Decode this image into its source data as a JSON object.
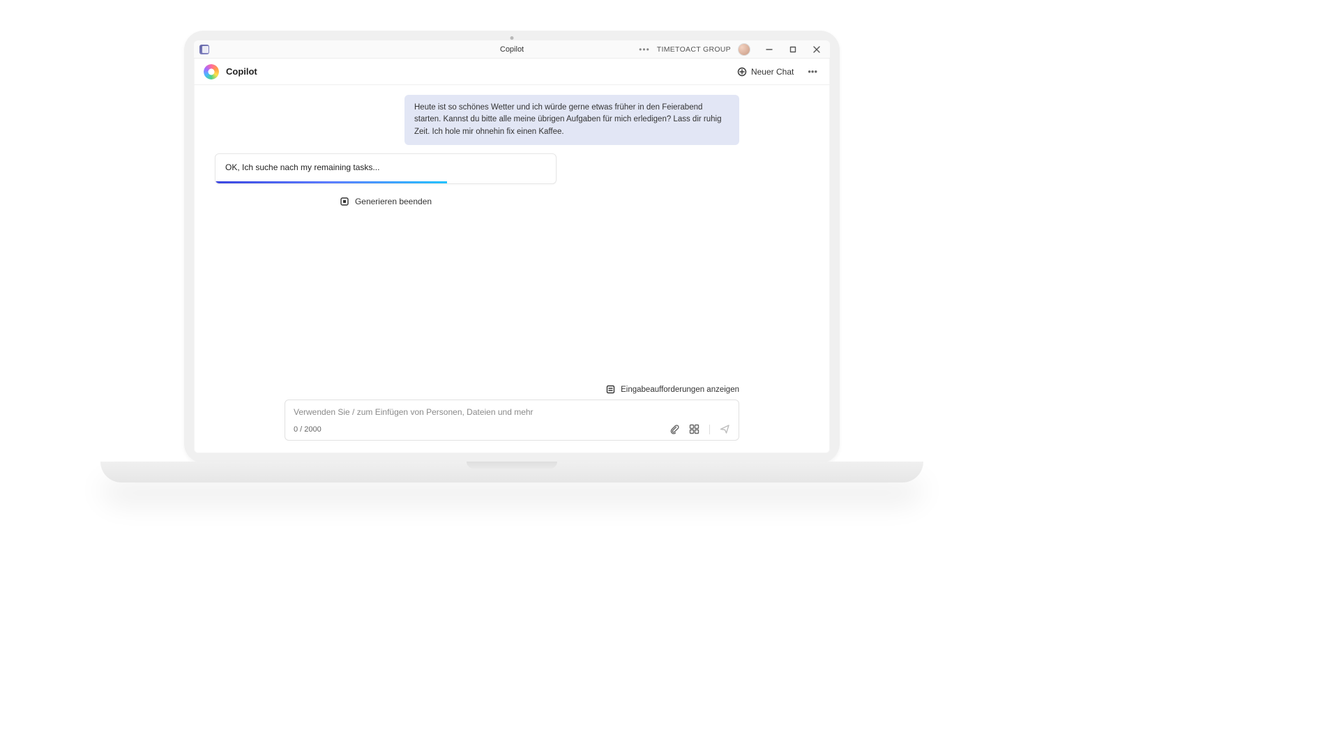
{
  "title_bar": {
    "app_title": "Copilot",
    "org_name": "TIMETOACT GROUP"
  },
  "toolbar": {
    "title": "Copilot",
    "new_chat_label": "Neuer Chat"
  },
  "chat": {
    "user_message": "Heute ist so schönes Wetter und ich würde gerne etwas früher in den Feierabend starten. Kannst du bitte alle meine übrigen Aufgaben für mich erledigen? Lass dir ruhig Zeit. Ich hole mir ohnehin fix einen Kaffee.",
    "assistant_message": "OK, Ich suche nach my remaining tasks...",
    "stop_label": "Generieren beenden",
    "progress_percent": 68
  },
  "footer": {
    "prompt_hint_label": "Eingabeaufforderungen anzeigen",
    "placeholder": "Verwenden Sie / zum Einfügen von Personen, Dateien und mehr",
    "char_count": "0 / 2000"
  }
}
